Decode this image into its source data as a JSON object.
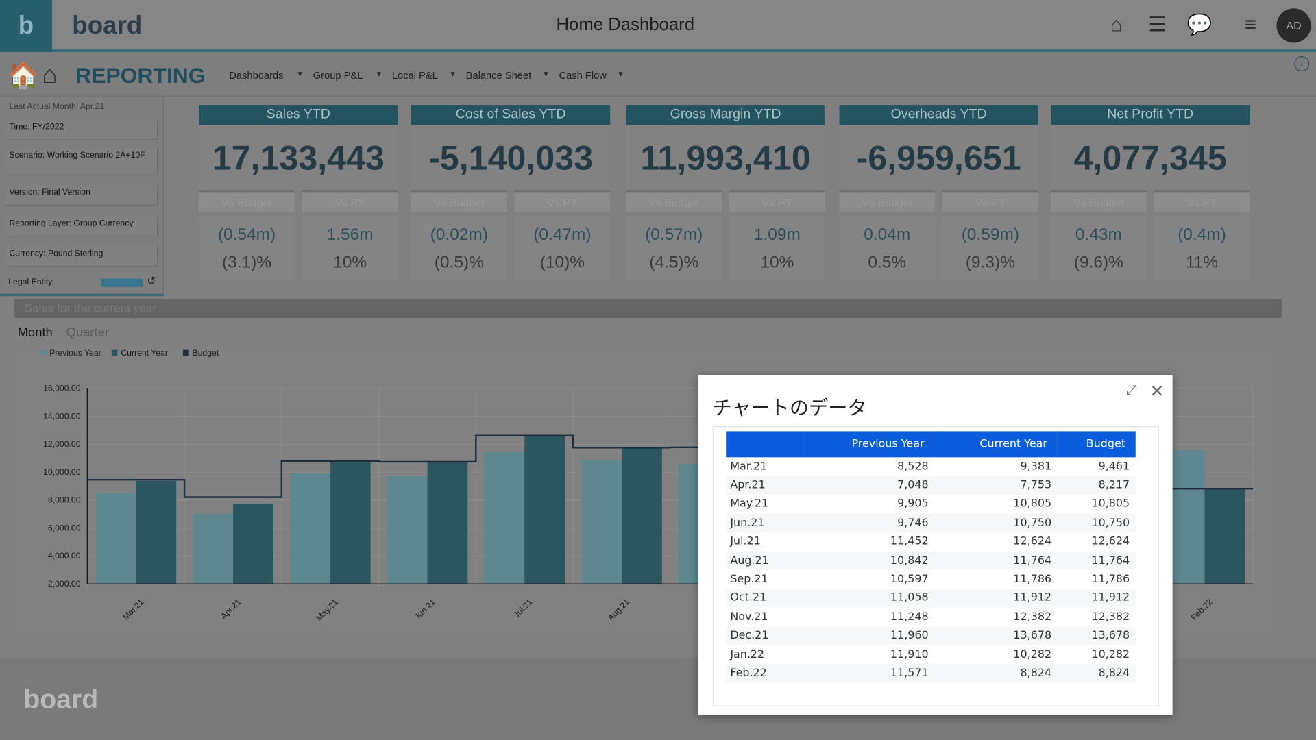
{
  "header": {
    "logo_letter": "b",
    "brand": "board",
    "title": "Home Dashboard",
    "icons": [
      "home-icon",
      "hierarchy-icon",
      "chat-icon",
      "hamburger-menu-icon"
    ],
    "avatar": "AD"
  },
  "nav": {
    "section": "REPORTING",
    "menus": [
      "Dashboards",
      "Group P&L",
      "Local P&L",
      "Balance Sheet",
      "Cash Flow"
    ]
  },
  "filters": {
    "last_actual": "Last Actual Month: Apr.21",
    "items": [
      "Time: FY/2022",
      "Scenario: Working Scenario 2A+10F",
      "Version: Final Version",
      "Reporting Layer: Group Currency",
      "Currency:  Pound Sterling"
    ],
    "legal_entity": "Legal Entity"
  },
  "kpis": [
    {
      "title": "Sales YTD",
      "value": "17,133,443",
      "vs_budget": "(0.54m)",
      "vs_budget_pct": "(3.1)%",
      "vs_py": "1.56m",
      "vs_py_pct": "10%"
    },
    {
      "title": "Cost of Sales YTD",
      "value": "-5,140,033",
      "vs_budget": "(0.02m)",
      "vs_budget_pct": "(0.5)%",
      "vs_py": "(0.47m)",
      "vs_py_pct": "(10)%"
    },
    {
      "title": "Gross Margin YTD",
      "value": "11,993,410",
      "vs_budget": "(0.57m)",
      "vs_budget_pct": "(4.5)%",
      "vs_py": "1.09m",
      "vs_py_pct": "10%"
    },
    {
      "title": "Overheads YTD",
      "value": "-6,959,651",
      "vs_budget": "0.04m",
      "vs_budget_pct": "0.5%",
      "vs_py": "(0.59m)",
      "vs_py_pct": "(9.3)%"
    },
    {
      "title": "Net Profit YTD",
      "value": "4,077,345",
      "vs_budget": "0.43m",
      "vs_budget_pct": "(9.6)%",
      "vs_py": "(0.4m)",
      "vs_py_pct": "11%"
    }
  ],
  "kpi_sub_labels": {
    "vs_budget": "Vs Budget",
    "vs_py": "Vs PY"
  },
  "section": {
    "title": "Sales for the current year",
    "tabs": [
      "Month",
      "Quarter"
    ],
    "active_tab": "Month"
  },
  "footer": {
    "logo": "board"
  },
  "chart_data": {
    "type": "bar",
    "categories": [
      "Mar.21",
      "Apr.21",
      "May.21",
      "Jun.21",
      "Jul.21",
      "Aug.21",
      "Sep.21",
      "Oct.21",
      "Nov.21",
      "Dec.21",
      "Jan.22",
      "Feb.22"
    ],
    "series": [
      {
        "name": "Previous Year",
        "values": [
          8528,
          7048,
          9905,
          9746,
          11452,
          10842,
          10597,
          11058,
          11248,
          11960,
          11910,
          11571
        ],
        "color": "#5f8790"
      },
      {
        "name": "Current Year",
        "values": [
          9381,
          7753,
          10805,
          10750,
          12624,
          11764,
          11786,
          11912,
          12382,
          13678,
          10282,
          8824
        ],
        "color": "#2b555f"
      },
      {
        "name": "Budget",
        "values": [
          9461,
          8217,
          10805,
          10750,
          12624,
          11764,
          11786,
          11912,
          12382,
          13678,
          10282,
          8824
        ],
        "color": "#1f2d3d",
        "style": "step-line"
      }
    ],
    "yticks": [
      "2,000.00",
      "4,000.00",
      "6,000.00",
      "8,000.00",
      "10,000.00",
      "12,000.00",
      "14,000.00",
      "16,000.00"
    ],
    "ylim": [
      2000,
      16000
    ],
    "grid": true,
    "legend": "top-left"
  },
  "modal": {
    "title": "チャートのデータ",
    "columns": [
      "",
      "Previous Year",
      "Current Year",
      "Budget"
    ],
    "rows": [
      [
        "Mar.21",
        "8,528",
        "9,381",
        "9,461"
      ],
      [
        "Apr.21",
        "7,048",
        "7,753",
        "8,217"
      ],
      [
        "May.21",
        "9,905",
        "10,805",
        "10,805"
      ],
      [
        "Jun.21",
        "9,746",
        "10,750",
        "10,750"
      ],
      [
        "Jul.21",
        "11,452",
        "12,624",
        "12,624"
      ],
      [
        "Aug.21",
        "10,842",
        "11,764",
        "11,764"
      ],
      [
        "Sep.21",
        "10,597",
        "11,786",
        "11,786"
      ],
      [
        "Oct.21",
        "11,058",
        "11,912",
        "11,912"
      ],
      [
        "Nov.21",
        "11,248",
        "12,382",
        "12,382"
      ],
      [
        "Dec.21",
        "11,960",
        "13,678",
        "13,678"
      ],
      [
        "Jan.22",
        "11,910",
        "10,282",
        "10,282"
      ],
      [
        "Feb.22",
        "11,571",
        "8,824",
        "8,824"
      ]
    ]
  }
}
